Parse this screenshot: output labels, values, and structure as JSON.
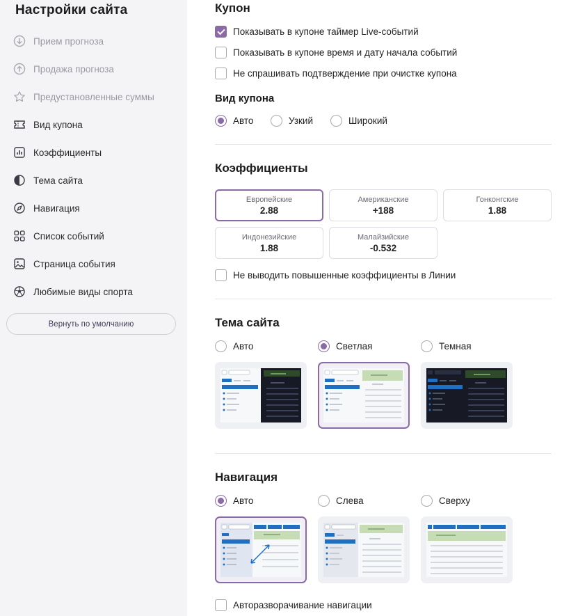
{
  "sidebar": {
    "title": "Настройки сайта",
    "items": [
      {
        "label": "Прием прогноза",
        "icon": "download-circle-icon",
        "muted": true
      },
      {
        "label": "Продажа прогноза",
        "icon": "upload-circle-icon",
        "muted": true
      },
      {
        "label": "Предустановленные суммы",
        "icon": "star-icon",
        "muted": true
      },
      {
        "label": "Вид купона",
        "icon": "ticket-icon",
        "muted": false
      },
      {
        "label": "Коэффициенты",
        "icon": "bar-chart-icon",
        "muted": false
      },
      {
        "label": "Тема сайта",
        "icon": "half-circle-icon",
        "muted": false
      },
      {
        "label": "Навигация",
        "icon": "compass-icon",
        "muted": false
      },
      {
        "label": "Список событий",
        "icon": "grid-icon",
        "muted": false
      },
      {
        "label": "Страница события",
        "icon": "image-icon",
        "muted": false
      },
      {
        "label": "Любимые виды спорта",
        "icon": "soccer-ball-icon",
        "muted": false
      }
    ],
    "reset_label": "Вернуть по умолчанию"
  },
  "coupon": {
    "title": "Купон",
    "options": [
      {
        "label": "Показывать в купоне таймер Live-событий",
        "checked": true
      },
      {
        "label": "Показывать в купоне время и дату начала событий",
        "checked": false
      },
      {
        "label": "Не спрашивать подтверждение при очистке купона",
        "checked": false
      }
    ],
    "view_title": "Вид купона",
    "views": [
      {
        "label": "Авто",
        "selected": true
      },
      {
        "label": "Узкий",
        "selected": false
      },
      {
        "label": "Широкий",
        "selected": false
      }
    ]
  },
  "odds": {
    "title": "Коэффициенты",
    "formats": [
      {
        "name": "Европейские",
        "value": "2.88",
        "selected": true
      },
      {
        "name": "Американские",
        "value": "+188",
        "selected": false
      },
      {
        "name": "Гонконгские",
        "value": "1.88",
        "selected": false
      },
      {
        "name": "Индонезийские",
        "value": "1.88",
        "selected": false
      },
      {
        "name": "Малайзийские",
        "value": "-0.532",
        "selected": false
      }
    ],
    "boosted_label": "Не выводить повышенные коэффициенты в Линии",
    "boosted_checked": false
  },
  "theme": {
    "title": "Тема сайта",
    "options": [
      {
        "label": "Авто",
        "selected": false
      },
      {
        "label": "Светлая",
        "selected": true
      },
      {
        "label": "Темная",
        "selected": false
      }
    ]
  },
  "navigation": {
    "title": "Навигация",
    "options": [
      {
        "label": "Авто",
        "selected": true
      },
      {
        "label": "Слева",
        "selected": false
      },
      {
        "label": "Сверху",
        "selected": false
      }
    ],
    "auto_expand_label": "Авторазворачивание навигации",
    "auto_expand_checked": false
  },
  "colors": {
    "accent": "#8b6aa8",
    "brand_blue": "#1f6fc2",
    "light_green": "#c5dcb4",
    "dark_bg": "#1b1e2a"
  }
}
